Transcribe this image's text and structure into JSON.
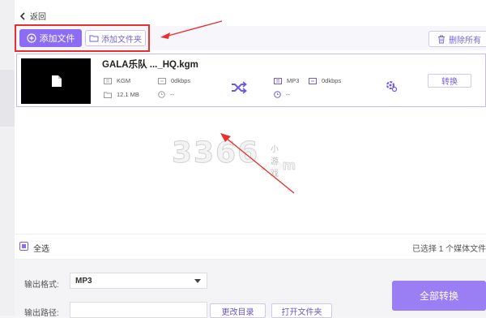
{
  "nav": {
    "back_label": "返回"
  },
  "toolbar": {
    "add_file_label": "添加文件",
    "add_folder_label": "添加文件夹",
    "delete_all_label": "删除所有"
  },
  "file": {
    "name": "GALA乐队 ..._HQ.kgm",
    "source_format": "KGM",
    "source_bitrate": "0dkbps",
    "size": "12.1 MB",
    "duration": "--",
    "target_format": "MP3",
    "target_bitrate": "0dkbps",
    "target_duration": "--",
    "convert_label": "转换"
  },
  "watermark": {
    "number": "3366",
    "domain": ".com",
    "tag": "小游戏"
  },
  "selection": {
    "select_all_label": "全选",
    "info": "已选择 1 个媒体文件"
  },
  "output": {
    "format_label": "输出格式:",
    "format_value": "MP3",
    "path_label": "输出路径:",
    "change_dir_label": "更改目录",
    "open_folder_label": "打开文件夹"
  },
  "convert_all_label": "全部转换",
  "colors": {
    "accent": "#8c6cf4",
    "annotation": "#e8312f"
  }
}
